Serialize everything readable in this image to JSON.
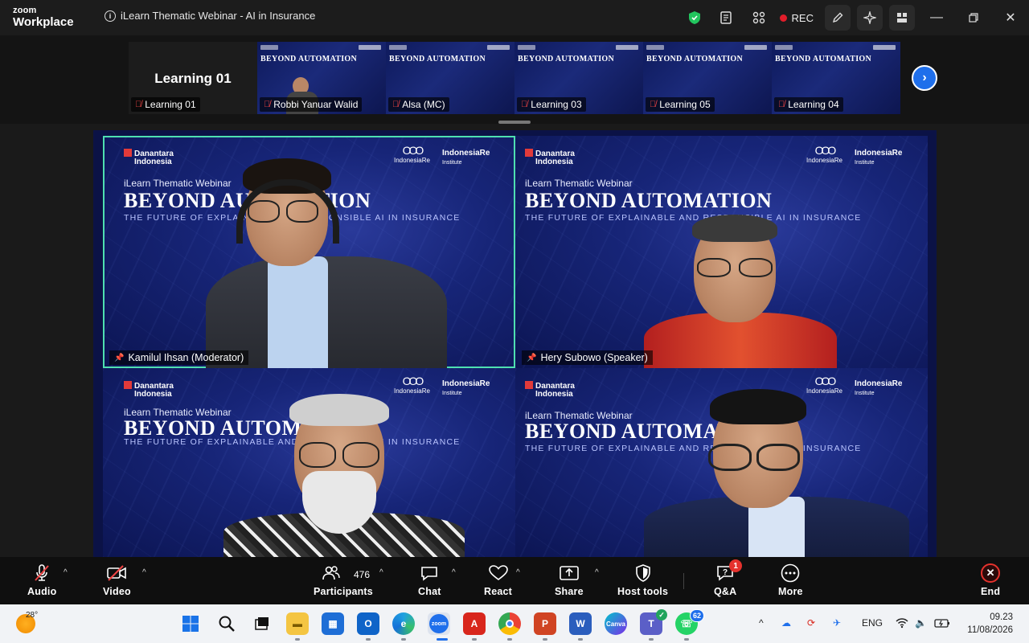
{
  "window": {
    "brand_top": "zoom",
    "brand_bottom": "Workplace",
    "title": "iLearn Thematic Webinar - AI in Insurance",
    "rec_label": "REC",
    "icons": [
      "shield-icon",
      "captions-icon",
      "apps-icon",
      "annotate-icon",
      "ai-companion-icon",
      "view-icon",
      "minimize-icon",
      "maximize-icon",
      "close-icon"
    ]
  },
  "filmstrip": {
    "self_name": "Learning 01",
    "self_label": "Learning 01",
    "thumbnails": [
      {
        "label": "Robbi Yanuar Walid"
      },
      {
        "label": "Alsa (MC)"
      },
      {
        "label": "Learning 03"
      },
      {
        "label": "Learning 05"
      },
      {
        "label": "Learning 04"
      }
    ],
    "thumb_slide_title": "BEYOND AUTOMATION",
    "next_icon": "chevron-right-icon"
  },
  "slide": {
    "brand_left": "Danantara",
    "brand_left_sub": "Indonesia",
    "brand_right": "IndonesiaRe",
    "brand_right2": "IndonesiaRe",
    "brand_right2_sub": "Institute",
    "kicker": "iLearn Thematic Webinar",
    "headline": "BEYOND AUTOMATION",
    "subtitle": "THE FUTURE OF EXPLAINABLE AND RESPONSIBLE AI IN INSURANCE",
    "footer": "Indonesia Re Institute"
  },
  "gallery": {
    "tiles": [
      {
        "name": "Kamilul Ihsan (Moderator)"
      },
      {
        "name": "Hery Subowo (Speaker)"
      },
      {
        "name": ""
      },
      {
        "name": ""
      }
    ]
  },
  "toolbar": {
    "audio": "Audio",
    "video": "Video",
    "participants": "Participants",
    "participant_count": "476",
    "chat": "Chat",
    "react": "React",
    "share": "Share",
    "host_tools": "Host tools",
    "qa": "Q&A",
    "qa_badge": "1",
    "more": "More",
    "end": "End"
  },
  "taskbar": {
    "temperature": "28°",
    "whatsapp_badge": "62",
    "language": "ENG",
    "time": "09.23",
    "date": "11/08/2026"
  }
}
